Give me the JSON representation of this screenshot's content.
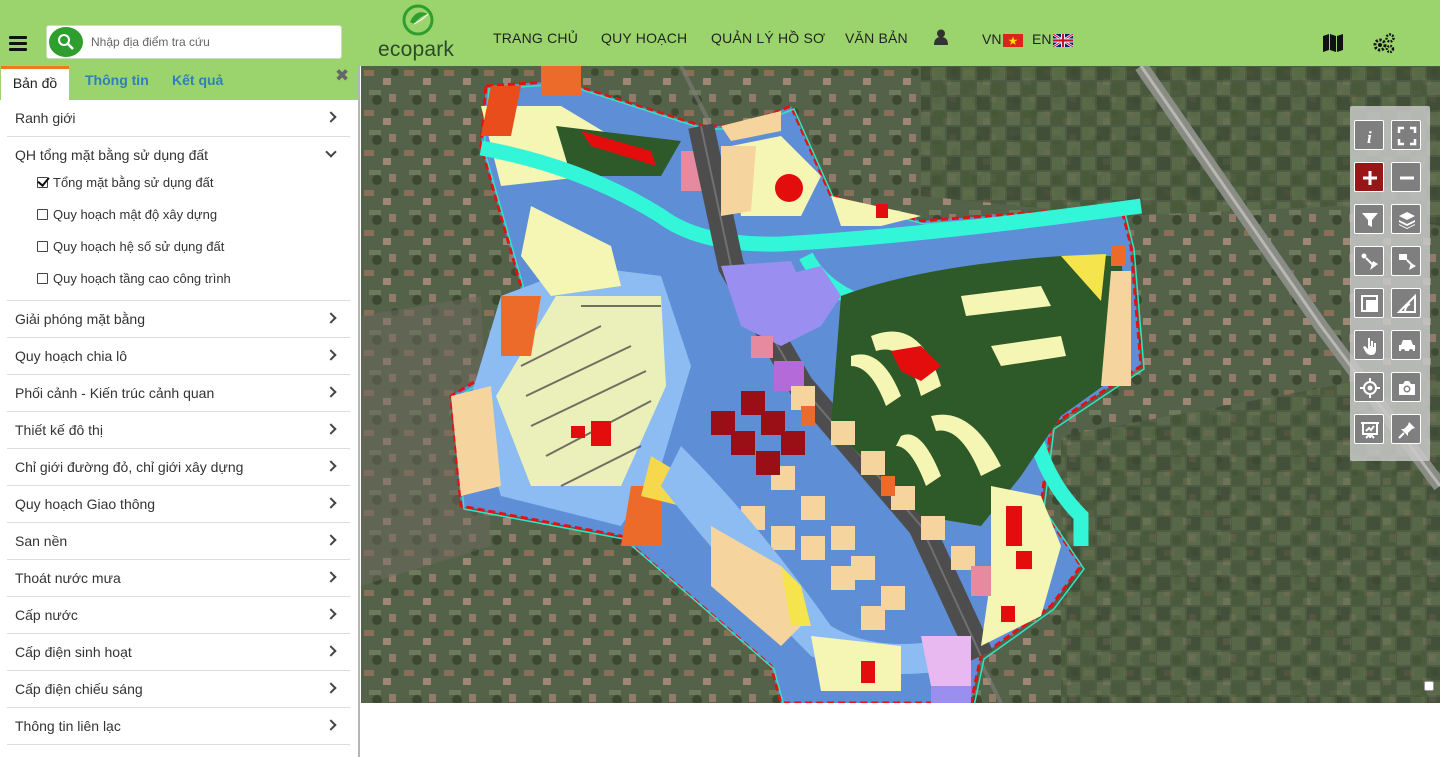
{
  "search": {
    "placeholder": "Nhập địa điểm tra cứu"
  },
  "brand": {
    "logo_text": "ecopark"
  },
  "nav": [
    "TRANG CHỦ",
    "QUY HOẠCH",
    "QUẢN LÝ HỒ SƠ",
    "VĂN BẢN"
  ],
  "lang": {
    "vn": "VN",
    "en": "EN"
  },
  "tabs": {
    "map": "Bản đồ",
    "info": "Thông tin",
    "result": "Kết quả"
  },
  "menu": [
    "Ranh giới",
    "QH tổng mặt bằng sử dụng đất",
    "Giải phóng mặt bằng",
    "Quy hoạch chia lô",
    "Phối cảnh - Kiến trúc cảnh quan",
    "Thiết kế đô thị",
    "Chỉ giới đường đỏ, chỉ giới xây dựng",
    "Quy hoạch Giao thông",
    "San nền",
    "Thoát nước mưa",
    "Cấp nước",
    "Cấp điện sinh hoạt",
    "Cấp điện chiếu sáng",
    "Thông tin liên lạc"
  ],
  "submenu": [
    {
      "label": "Tổng mặt bằng sử dụng đất",
      "checked": true
    },
    {
      "label": "Quy hoạch mật độ xây dựng",
      "checked": false
    },
    {
      "label": "Quy hoạch hệ số sử dụng đất",
      "checked": false
    },
    {
      "label": "Quy hoạch tầng cao công trình",
      "checked": false
    }
  ],
  "colors": {
    "header": "#9bd46c",
    "tab_accent": "#f07a1a",
    "tab_link": "#2f7fb8",
    "canal": "#33f5d8",
    "water": "#8dbcf2",
    "residential": "#f5f5b4",
    "greenery": "#2e5a2a",
    "commercial": "#f6d49e"
  },
  "tools": [
    "info-icon",
    "fullscreen-icon",
    "zoom-in-icon",
    "zoom-out-icon",
    "filter-icon",
    "layers-icon",
    "select-point-icon",
    "select-area-icon",
    "measure-area-icon",
    "measure-angle-icon",
    "hand-icon",
    "car-icon",
    "locate-icon",
    "camera-icon",
    "print-icon",
    "pin-icon"
  ]
}
